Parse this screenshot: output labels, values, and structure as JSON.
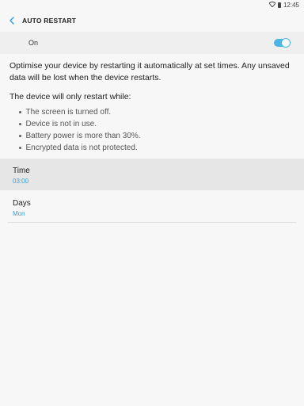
{
  "status_bar": {
    "time": "12:45",
    "icons": [
      "wifi-icon",
      "battery-icon"
    ]
  },
  "app_bar": {
    "back_icon": "chevron-left-icon",
    "title": "AUTO RESTART"
  },
  "master_switch": {
    "label": "On",
    "state": true,
    "accent_color": "#4bb5e3"
  },
  "description": "Optimise your device by restarting it automatically at set times. Any unsaved data will be lost when the device restarts.",
  "conditions": {
    "heading": "The device will only restart while:",
    "items": [
      "The screen is turned off.",
      "Device is not in use.",
      "Battery power is more than 30%.",
      "Encrypted data is not protected."
    ]
  },
  "settings": [
    {
      "label": "Time",
      "value": "03:00"
    },
    {
      "label": "Days",
      "value": "Mon"
    }
  ],
  "colors": {
    "value_text": "#3a9fd2",
    "background": "#f7f7f7",
    "highlight_row": "#e6e6e6"
  }
}
